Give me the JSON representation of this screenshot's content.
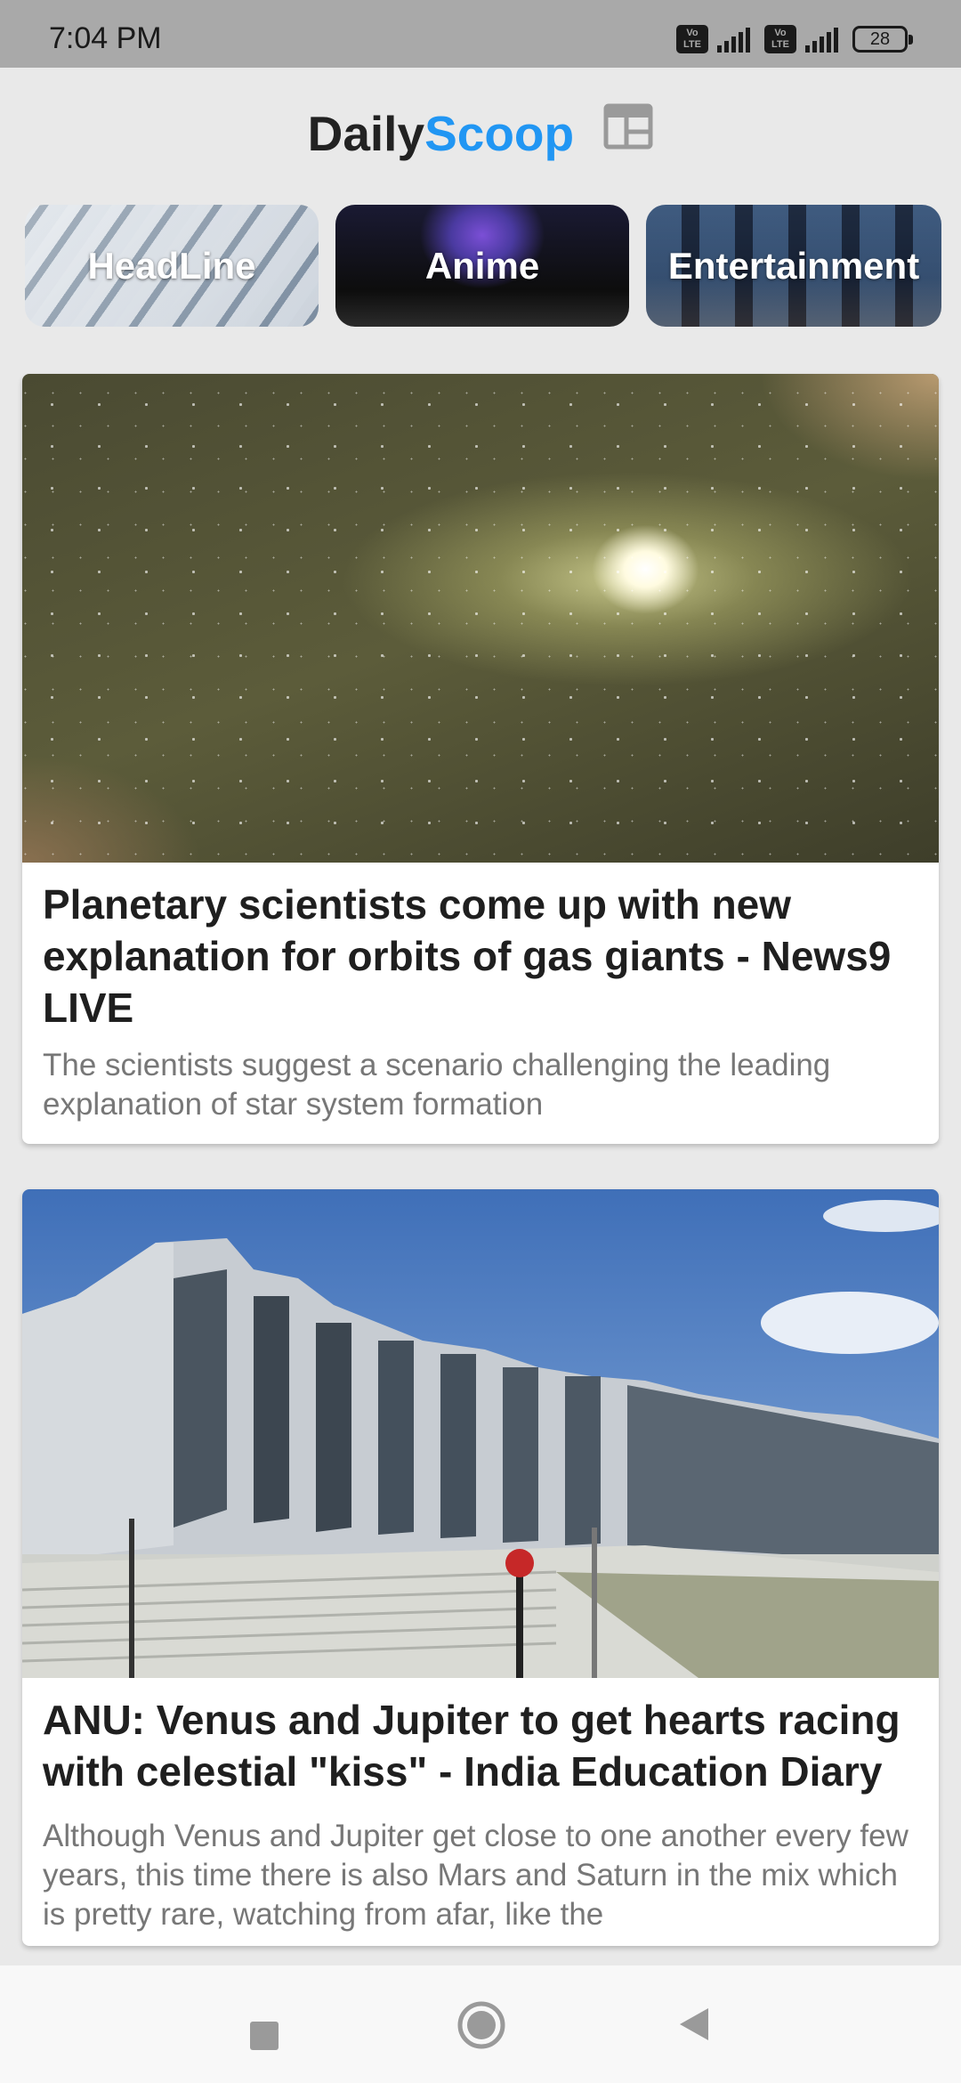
{
  "status_bar": {
    "time": "7:04 PM",
    "volte1": "Vo LTE",
    "volte2": "Vo LTE",
    "battery": "28"
  },
  "header": {
    "title_part1": "Daily",
    "title_part2": "Scoop",
    "icon": "newspaper-icon",
    "title_color": "#222222",
    "accent_color": "#2196f3"
  },
  "categories": [
    {
      "label": "HeadLine"
    },
    {
      "label": "Anime"
    },
    {
      "label": "Entertainment"
    }
  ],
  "articles": [
    {
      "title": "Planetary scientists come up with new explanation for orbits of gas giants - News9 LIVE",
      "description": "The scientists suggest a scenario challenging the leading explanation of star system formation"
    },
    {
      "title": "ANU: Venus and Jupiter to get hearts racing with celestial \"kiss\" - India Education Diary",
      "description": "Although Venus and Jupiter get close to one another every few years, this time there is also Mars and Saturn in the mix which is pretty rare, watching from afar, like the"
    }
  ],
  "nav_bar": {
    "recents": "square-icon",
    "home": "circle-icon",
    "back": "triangle-back-icon"
  }
}
